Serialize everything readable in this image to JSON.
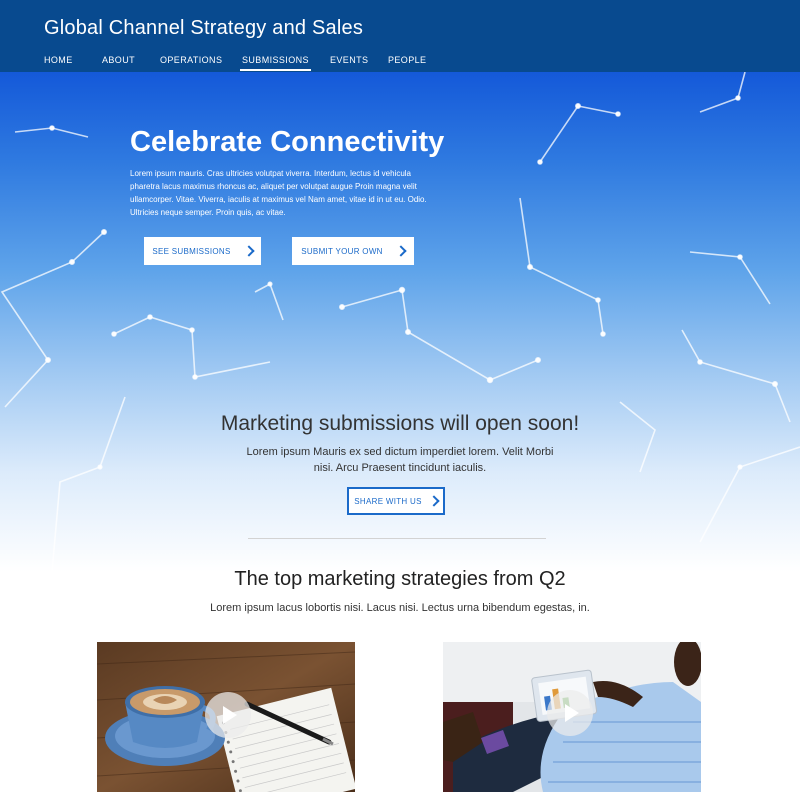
{
  "header": {
    "title": "Global Channel Strategy and Sales",
    "nav": [
      {
        "label": "HOME",
        "active": false
      },
      {
        "label": "ABOUT",
        "active": false
      },
      {
        "label": "OPERATIONS",
        "active": false
      },
      {
        "label": "SUBMISSIONS",
        "active": true
      },
      {
        "label": "EVENTS",
        "active": false
      },
      {
        "label": "PEOPLE",
        "active": false
      }
    ]
  },
  "hero": {
    "title": "Celebrate Connectivity",
    "body": "Lorem ipsum mauris. Cras ultricies volutpat viverra. Interdum, lectus id vehicula pharetra lacus maximus rhoncus ac, aliquet per volutpat augue Proin magna velit ullamcorper. Vitae. Viverra, iaculis at maximus vel Nam amet, vitae id in ut eu. Odio. Ultricies neque semper. Proin quis, ac vitae.",
    "buttons": {
      "see_submissions": "SEE SUBMISSIONS",
      "submit_your_own": "SUBMIT YOUR OWN"
    }
  },
  "notice": {
    "title": "Marketing submissions will open soon!",
    "body": "Lorem ipsum Mauris ex sed dictum imperdiet lorem. Velit Morbi nisi. Arcu Praesent tincidunt iaculis.",
    "button": "SHARE WITH US"
  },
  "strategies": {
    "title": "The top marketing strategies from Q2",
    "body": "Lorem ipsum lacus lobortis nisi. Lacus nisi. Lectus urna bibendum egestas, in."
  },
  "icons": {
    "chevron": "chevron-right-icon",
    "play": "play-icon"
  },
  "colors": {
    "header_bg": "#084a8f",
    "accent": "#1b6ac9",
    "hero_top": "#1459d9"
  }
}
